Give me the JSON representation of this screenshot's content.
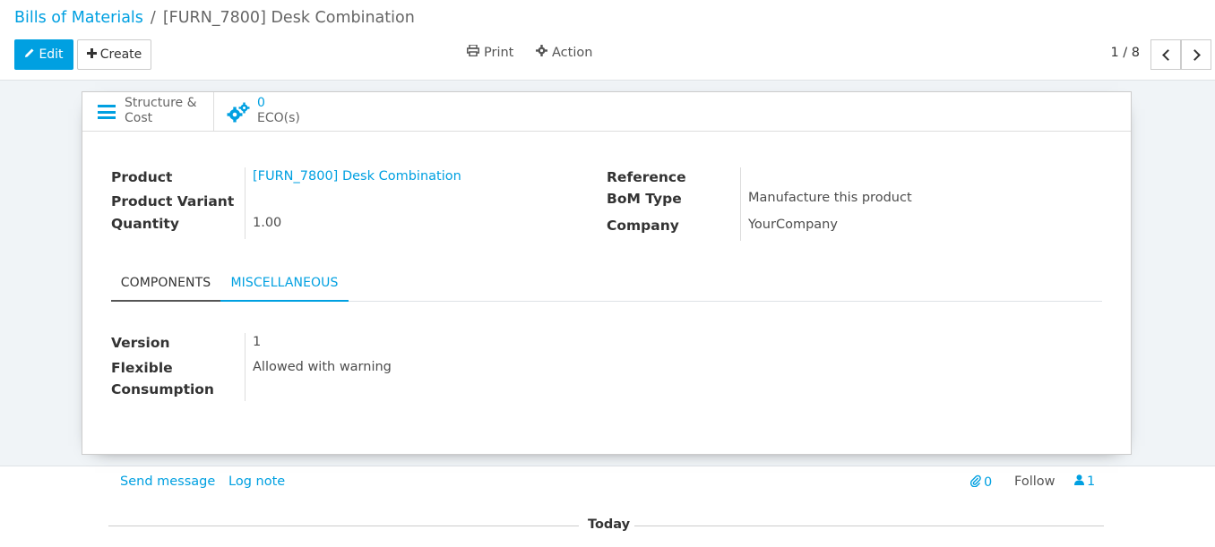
{
  "breadcrumb": {
    "parent": "Bills of Materials",
    "separator": "/",
    "current": "[FURN_7800] Desk Combination"
  },
  "toolbar": {
    "edit_label": "Edit",
    "create_label": "Create",
    "print_label": "Print",
    "action_label": "Action"
  },
  "pager": {
    "value": "1 / 8"
  },
  "button_box": {
    "structure_label_line1": "Structure &",
    "structure_label_line2": "Cost",
    "eco_count": "0",
    "eco_label": "ECO(s)"
  },
  "fields": {
    "product_label": "Product",
    "product_value": "[FURN_7800] Desk Combination",
    "variant_label": "Product Variant",
    "variant_value": "",
    "quantity_label": "Quantity",
    "quantity_value": "1.00",
    "reference_label": "Reference",
    "reference_value": "",
    "bom_type_label": "BoM Type",
    "bom_type_value": "Manufacture this product",
    "company_label": "Company",
    "company_value": "YourCompany"
  },
  "tabs": [
    {
      "label": "COMPONENTS",
      "active": false
    },
    {
      "label": "MISCELLANEOUS",
      "active": true
    }
  ],
  "misc": {
    "version_label": "Version",
    "version_value": "1",
    "flexible_label_line1": "Flexible",
    "flexible_label_line2": "Consumption",
    "flexible_value": "Allowed with warning"
  },
  "chatter": {
    "send_message": "Send message",
    "log_note": "Log note",
    "attachments_count": "0",
    "follow_label": "Follow",
    "followers_count": "1",
    "today_label": "Today"
  },
  "colors": {
    "accent": "#00a0e1",
    "background": "#f0f4f7"
  }
}
